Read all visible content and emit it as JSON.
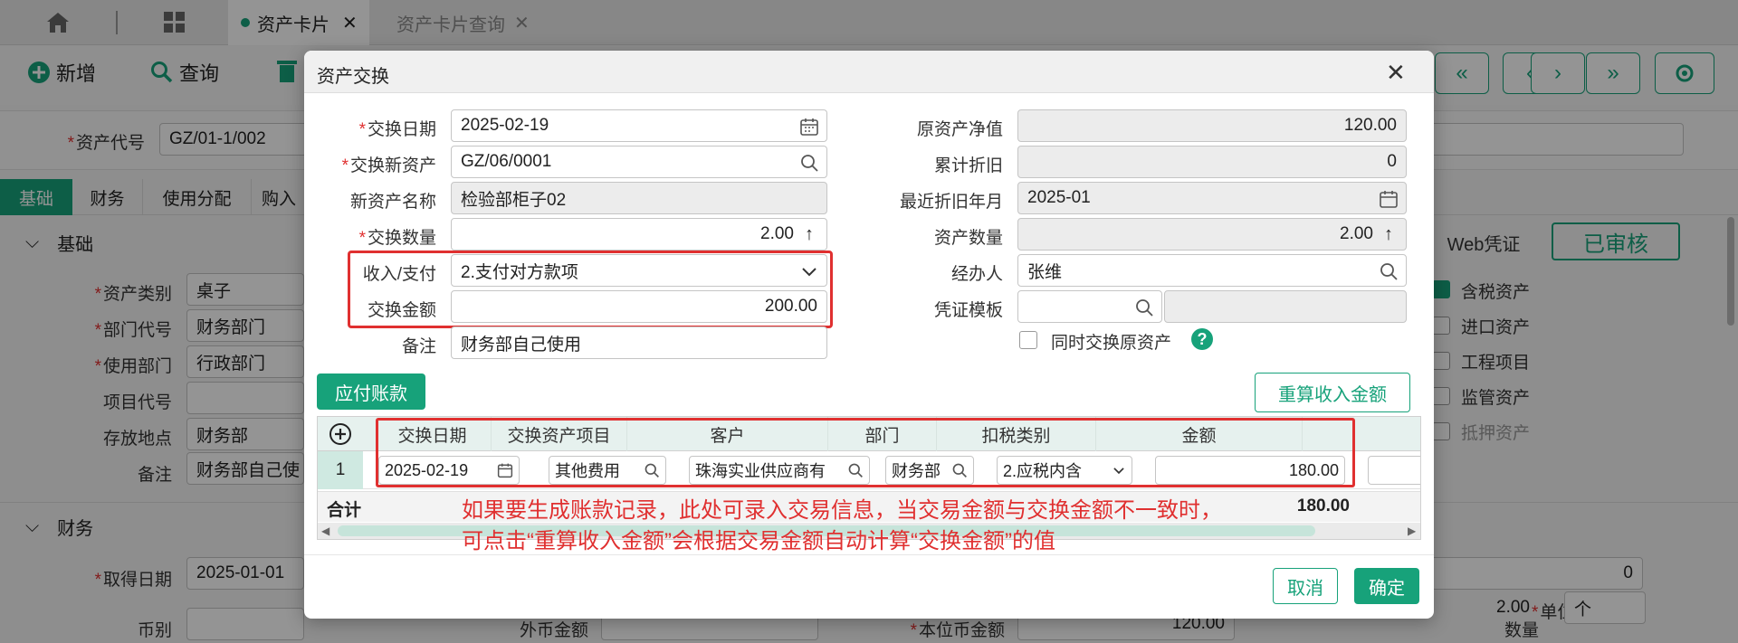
{
  "tabs": {
    "tab1": "资产卡片",
    "tab2": "资产卡片查询"
  },
  "toolbar": {
    "add": "新增",
    "query": "查询"
  },
  "form": {
    "asset_code_label": "资产代号",
    "asset_code": "GZ/01-1/002",
    "subtabs": [
      "基础",
      "财务",
      "使用分配",
      "购入"
    ],
    "section_basic": "基础",
    "asset_class_label": "资产类别",
    "asset_class": "桌子",
    "dept_code_label": "部门代号",
    "dept_code": "财务部门",
    "use_dept_label": "使用部门",
    "use_dept": "行政部门",
    "project_label": "项目代号",
    "location_label": "存放地点",
    "location": "财务部",
    "remark_label": "备注",
    "remark": "财务部自己使",
    "section_finance": "财务",
    "acq_date_label": "取得日期",
    "acq_date": "2025-01-01",
    "currency_label": "币别",
    "foreign_amount_label": "外币金额",
    "local_amount_label": "本位币金额",
    "local_amount": "120.00",
    "qty_label": "数量",
    "qty_value": "2.00",
    "unit_label": "单位",
    "unit_value": "个",
    "right_zero": "0",
    "web_voucher": "Web凭证",
    "audited": "已审核",
    "checkboxes": [
      "含税资产",
      "进口资产",
      "工程项目",
      "监管资产",
      "抵押资产"
    ]
  },
  "dialog": {
    "title": "资产交换",
    "exchange_date_label": "交换日期",
    "exchange_date": "2025-02-19",
    "new_asset_label": "交换新资产",
    "new_asset": "GZ/06/0001",
    "new_asset_name_label": "新资产名称",
    "new_asset_name": "检验部柜子02",
    "exchange_qty_label": "交换数量",
    "exchange_qty": "2.00",
    "income_pay_label": "收入/支付",
    "income_pay": "2.支付对方款项",
    "exchange_amount_label": "交换金额",
    "exchange_amount": "200.00",
    "remark_label": "备注",
    "remark": "财务部自己使用",
    "orig_net_label": "原资产净值",
    "orig_net": "120.00",
    "accum_dep_label": "累计折旧",
    "accum_dep": "0",
    "last_dep_label": "最近折旧年月",
    "last_dep": "2025-01",
    "asset_qty_label": "资产数量",
    "asset_qty": "2.00",
    "handler_label": "经办人",
    "handler": "张维",
    "voucher_tpl_label": "凭证模板",
    "simul_label": "同时交换原资产",
    "payable_btn": "应付账款",
    "recalc_btn": "重算收入金额",
    "grid": {
      "headers": [
        "交换日期",
        "交换资产项目",
        "客户",
        "部门",
        "扣税类别",
        "金额"
      ],
      "row_no": "1",
      "row": [
        "2025-02-19",
        "其他费用",
        "珠海实业供应商有",
        "财务部",
        "2.应税内含",
        "180.00"
      ],
      "total_label": "合计",
      "total": "180.00"
    },
    "annotation_line1": "如果要生成账款记录，此处可录入交易信息，当交易金额与交换金额不一致时，",
    "annotation_line2": "可点击“重算收入金额”会根据交易金额自动计算“交换金额”的值",
    "cancel": "取消",
    "ok": "确定"
  },
  "colors": {
    "accent": "#17a27a",
    "highlight": "#e03030"
  }
}
